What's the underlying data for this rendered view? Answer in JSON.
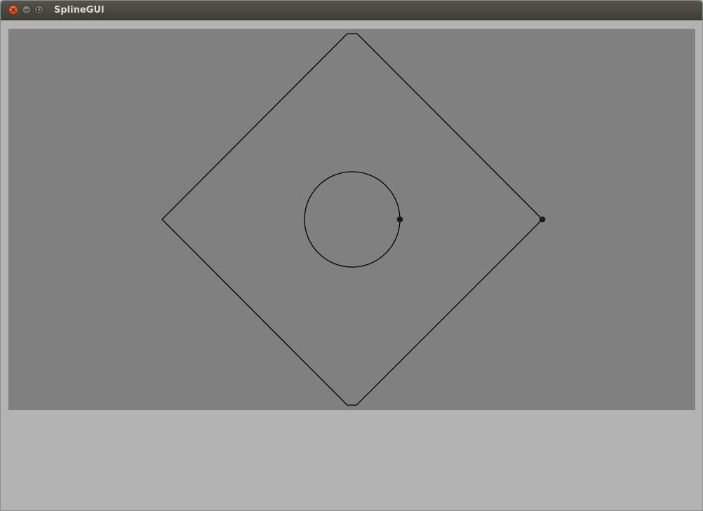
{
  "window": {
    "title": "SplineGUI"
  },
  "icons": {
    "close": "close-icon",
    "minimize": "minimize-icon",
    "maximize": "maximize-icon"
  },
  "colors": {
    "canvas_background": "#808080",
    "window_background": "#b3b3b3",
    "curve_stroke": "#000000",
    "control_point": "#1a1a1a"
  }
}
